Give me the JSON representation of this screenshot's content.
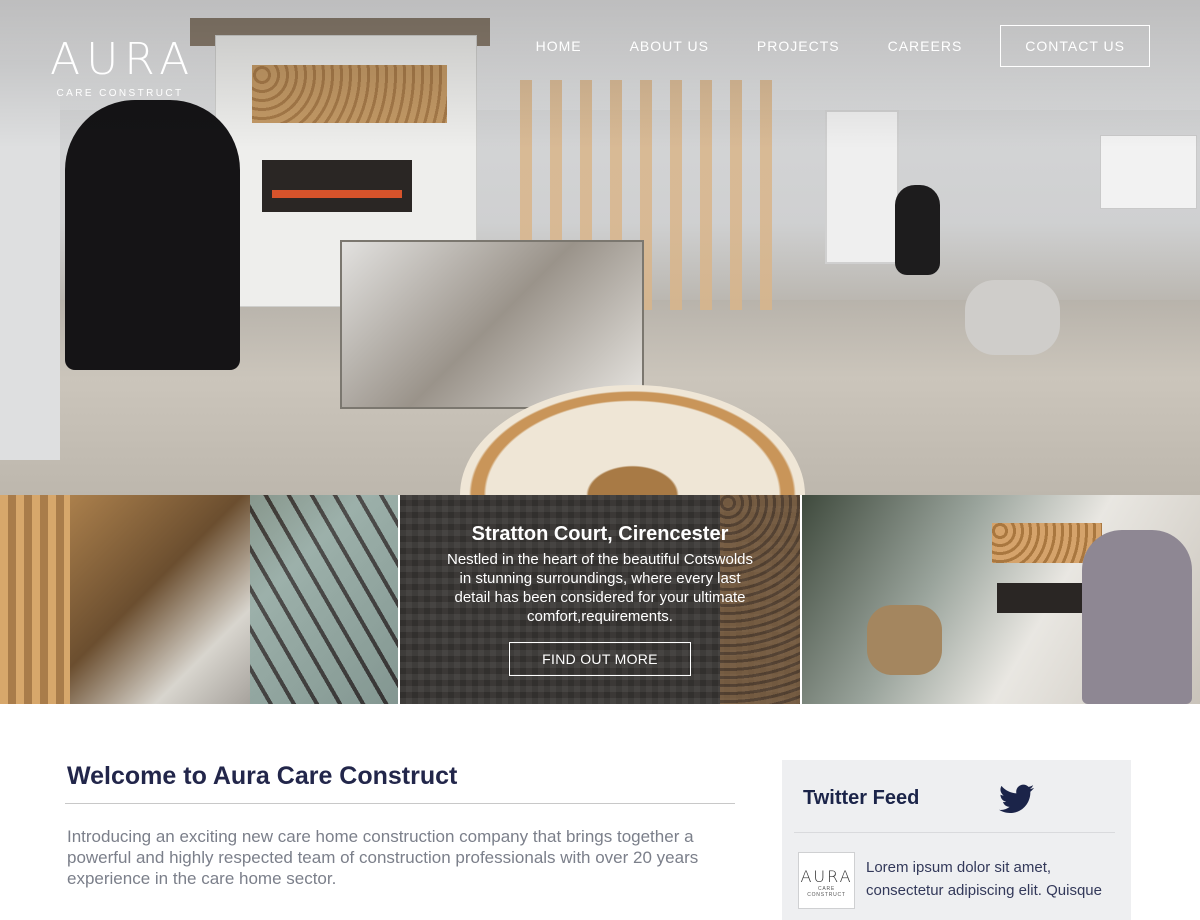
{
  "brand": {
    "name": "AURA",
    "tagline": "CARE CONSTRUCT"
  },
  "nav": {
    "items": [
      {
        "label": "HOME",
        "active": true
      },
      {
        "label": "ABOUT US"
      },
      {
        "label": "PROJECTS"
      },
      {
        "label": "CAREERS"
      }
    ],
    "contact_label": "CONTACT US"
  },
  "featured_project": {
    "title": "Stratton Court, Cirencester",
    "description": "Nestled in the heart of the beautiful Cotswolds in stunning surroundings, where every last detail has been considered for your ultimate comfort,requirements.",
    "cta_label": "FIND OUT MORE"
  },
  "welcome": {
    "heading": "Welcome to Aura Care Construct",
    "body": "Introducing an exciting new care home construction company that brings together a powerful and highly respected team of construction professionals with over 20 years experience in the care home sector."
  },
  "twitter": {
    "heading": "Twitter Feed",
    "icon": "twitter-bird-icon",
    "avatar_name": "AURA",
    "avatar_sub": "CARE CONSTRUCT",
    "tweet_text": "Lorem ipsum dolor sit amet, consectetur adipiscing elit. Quisque"
  },
  "colors": {
    "heading_navy": "#22264a",
    "body_grey": "#7b7f8a",
    "twitter_icon": "#1b2449",
    "panel_bg": "#eeeff1"
  }
}
